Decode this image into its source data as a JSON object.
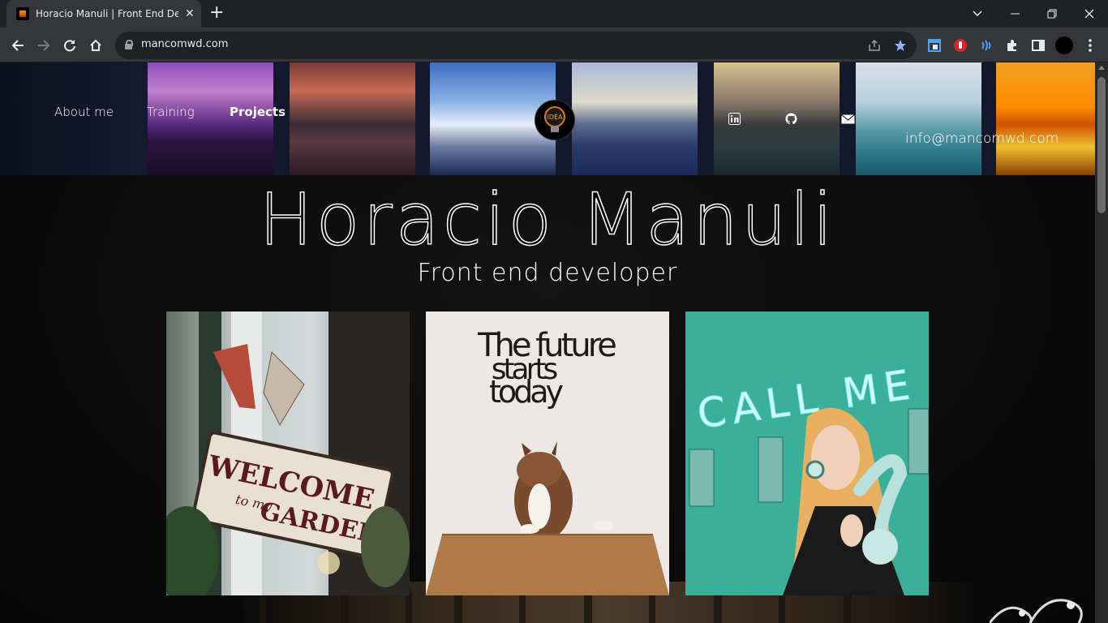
{
  "browser": {
    "tab_title": "Horacio Manuli | Front End Developer",
    "url": "mancomwd.com",
    "close_glyph": "✕",
    "new_tab_glyph": "+"
  },
  "nav": {
    "about": "About me",
    "training": "Training",
    "projects": "Projects"
  },
  "logo_text": "IDEA",
  "social": {
    "linkedin": "in",
    "github": "github",
    "mail": "mail"
  },
  "email": "info@mancomwd.com",
  "hero": {
    "name": "Horacio Manuli",
    "subtitle": "Front end developer"
  },
  "cards": [
    {
      "sign": "WELCOME",
      "sign2": "to my",
      "sign3": "GARDEN"
    },
    {
      "line1": "The future",
      "line2": "starts",
      "line3": "today"
    },
    {
      "neon": "CALL ME"
    }
  ],
  "colors": {
    "chrome_dark": "#202124",
    "chrome_mid": "#35363a",
    "star_blue": "#8ab4f8",
    "neon": "#c8fbff"
  }
}
